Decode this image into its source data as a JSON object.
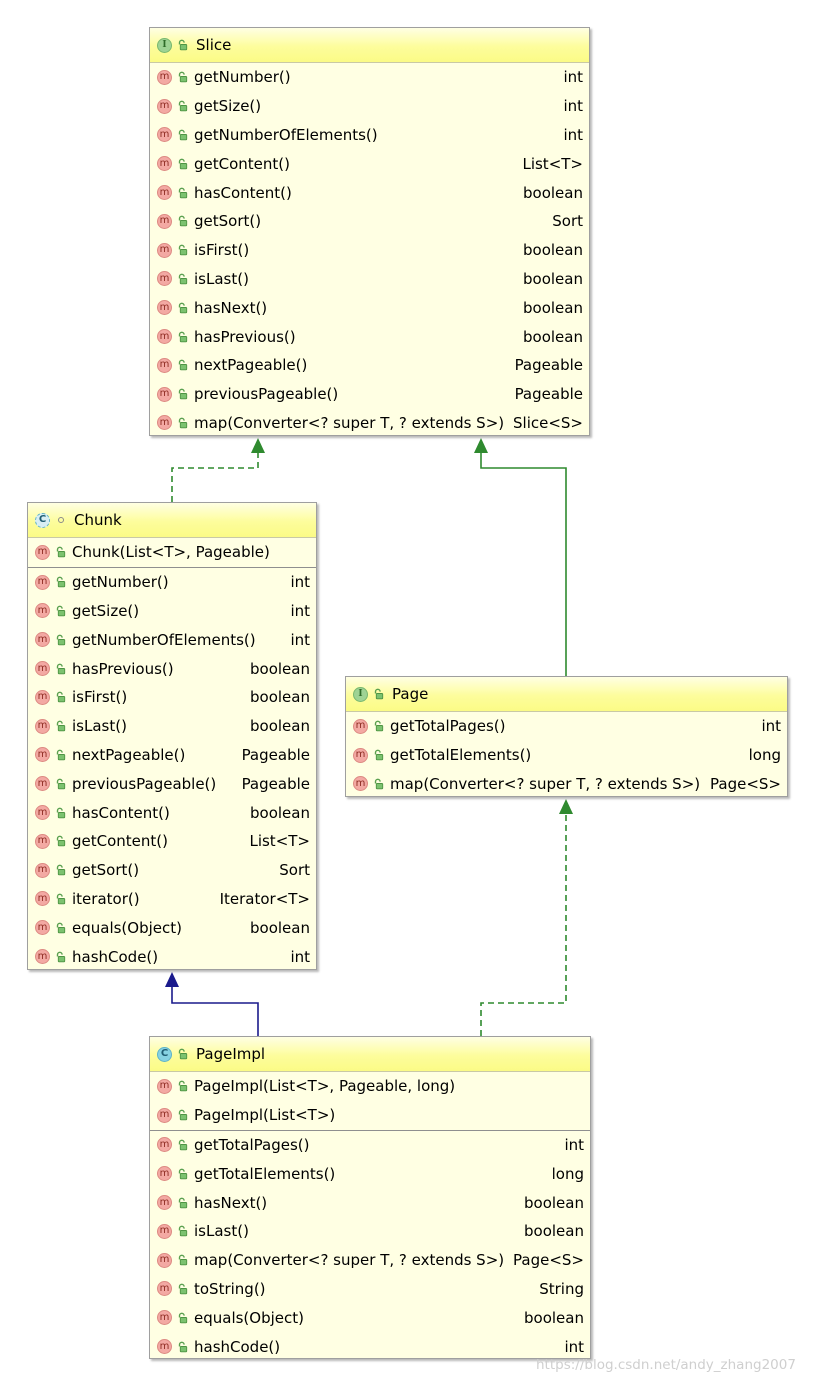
{
  "colors": {
    "realization_edge": "#2f8a2f",
    "inheritance_edge": "#1a1a8c",
    "box_fill": "#ffffe3",
    "header_fill": "#fbfb86"
  },
  "classes": [
    {
      "id": "slice",
      "kind": "interface",
      "kind_letter": "I",
      "name": "Slice",
      "visibility_icon": "lock-open-icon",
      "sections": [
        [
          {
            "name": "getNumber()",
            "type": "int"
          },
          {
            "name": "getSize()",
            "type": "int"
          },
          {
            "name": "getNumberOfElements()",
            "type": "int"
          },
          {
            "name": "getContent()",
            "type": "List<T>"
          },
          {
            "name": "hasContent()",
            "type": "boolean"
          },
          {
            "name": "getSort()",
            "type": "Sort"
          },
          {
            "name": "isFirst()",
            "type": "boolean"
          },
          {
            "name": "isLast()",
            "type": "boolean"
          },
          {
            "name": "hasNext()",
            "type": "boolean"
          },
          {
            "name": "hasPrevious()",
            "type": "boolean"
          },
          {
            "name": "nextPageable()",
            "type": "Pageable"
          },
          {
            "name": "previousPageable()",
            "type": "Pageable"
          },
          {
            "name": "map(Converter<? super T, ? extends S>)",
            "type": "Slice<S>"
          }
        ]
      ]
    },
    {
      "id": "chunk",
      "kind": "abstract-class",
      "kind_letter": "C",
      "name": "Chunk",
      "visibility_icon": "package-private-icon",
      "sections": [
        [
          {
            "name": "Chunk(List<T>, Pageable)",
            "type": ""
          }
        ],
        [
          {
            "name": "getNumber()",
            "type": "int"
          },
          {
            "name": "getSize()",
            "type": "int"
          },
          {
            "name": "getNumberOfElements()",
            "type": "int"
          },
          {
            "name": "hasPrevious()",
            "type": "boolean"
          },
          {
            "name": "isFirst()",
            "type": "boolean"
          },
          {
            "name": "isLast()",
            "type": "boolean"
          },
          {
            "name": "nextPageable()",
            "type": "Pageable"
          },
          {
            "name": "previousPageable()",
            "type": "Pageable"
          },
          {
            "name": "hasContent()",
            "type": "boolean"
          },
          {
            "name": "getContent()",
            "type": "List<T>"
          },
          {
            "name": "getSort()",
            "type": "Sort"
          },
          {
            "name": "iterator()",
            "type": "Iterator<T>"
          },
          {
            "name": "equals(Object)",
            "type": "boolean"
          },
          {
            "name": "hashCode()",
            "type": "int"
          }
        ]
      ]
    },
    {
      "id": "page",
      "kind": "interface",
      "kind_letter": "I",
      "name": "Page",
      "visibility_icon": "lock-open-icon",
      "sections": [
        [
          {
            "name": "getTotalPages()",
            "type": "int"
          },
          {
            "name": "getTotalElements()",
            "type": "long"
          },
          {
            "name": "map(Converter<? super T, ? extends S>)",
            "type": "Page<S>"
          }
        ]
      ]
    },
    {
      "id": "pageimpl",
      "kind": "class",
      "kind_letter": "C",
      "name": "PageImpl",
      "visibility_icon": "lock-open-icon",
      "sections": [
        [
          {
            "name": "PageImpl(List<T>, Pageable, long)",
            "type": ""
          },
          {
            "name": "PageImpl(List<T>)",
            "type": ""
          }
        ],
        [
          {
            "name": "getTotalPages()",
            "type": "int"
          },
          {
            "name": "getTotalElements()",
            "type": "long"
          },
          {
            "name": "hasNext()",
            "type": "boolean"
          },
          {
            "name": "isLast()",
            "type": "boolean"
          },
          {
            "name": "map(Converter<? super T, ? extends S>)",
            "type": "Page<S>"
          },
          {
            "name": "toString()",
            "type": "String"
          },
          {
            "name": "equals(Object)",
            "type": "boolean"
          },
          {
            "name": "hashCode()",
            "type": "int"
          }
        ]
      ]
    }
  ],
  "method_badge_letter": "m",
  "method_visibility_icon": "lock-open-icon",
  "relations": [
    {
      "from": "chunk",
      "to": "slice",
      "type": "realization"
    },
    {
      "from": "page",
      "to": "slice",
      "type": "generalization"
    },
    {
      "from": "pageimpl",
      "to": "chunk",
      "type": "generalization"
    },
    {
      "from": "pageimpl",
      "to": "page",
      "type": "realization"
    }
  ],
  "watermark": "https://blog.csdn.net/andy_zhang2007"
}
